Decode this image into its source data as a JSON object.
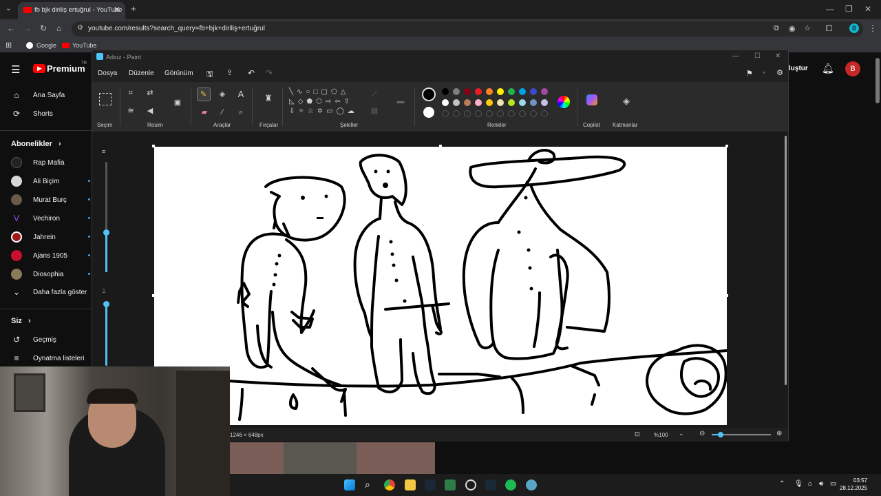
{
  "browser": {
    "tab_title": "fb bjk diriliş ertuğrul - YouTube",
    "url": "youtube.com/results?search_query=fb+bjk+diriliş+ertuğrul",
    "bookmarks": [
      "Google",
      "YouTube"
    ],
    "profile_initial": "B"
  },
  "youtube": {
    "logo": "Premium",
    "logo_region": "TR",
    "create_label": "luştur",
    "user_initial": "B",
    "nav": [
      {
        "label": "Ana Sayfa",
        "icon": "home-icon"
      },
      {
        "label": "Shorts",
        "icon": "shorts-icon"
      }
    ],
    "subscriptions_header": "Abonelikler",
    "subscriptions": [
      {
        "label": "Rap Mafia",
        "color": "#222222"
      },
      {
        "label": "Ali Biçim",
        "color": "#d8d8d8"
      },
      {
        "label": "Murat Burç",
        "color": "#6a5a4a"
      },
      {
        "label": "Vechiron",
        "color": "#7b2fbf"
      },
      {
        "label": "Jahrein",
        "color": "#a01818"
      },
      {
        "label": "Ajans 1905",
        "color": "#c8102e"
      },
      {
        "label": "Diosophia",
        "color": "#8a7a5a"
      }
    ],
    "show_more": "Daha fazla göster",
    "you_header": "Siz",
    "you_items": [
      {
        "label": "Geçmiş",
        "icon": "history-icon"
      },
      {
        "label": "Oynatma listeleri",
        "icon": "playlist-icon"
      }
    ]
  },
  "paint": {
    "window_title": "Adsız - Paint",
    "menu": [
      "Dosya",
      "Düzenle",
      "Görünüm"
    ],
    "groups": [
      "Seçim",
      "Resim",
      "Araçlar",
      "Fırçalar",
      "Şekiller",
      "Renkler",
      "Copilot",
      "Katmanlar"
    ],
    "palette_row1": [
      "#000000",
      "#7f7f7f",
      "#880015",
      "#ed1c24",
      "#ff7f27",
      "#fff200",
      "#22b14c",
      "#00a2e8",
      "#3f48cc",
      "#a349a4"
    ],
    "palette_row2": [
      "#ffffff",
      "#c3c3c3",
      "#b97a57",
      "#ffaec9",
      "#ffc90e",
      "#efe4b0",
      "#b5e61d",
      "#99d9ea",
      "#7092be",
      "#c8bfe7"
    ],
    "canvas_size": "1246 × 648px",
    "zoom": "%100"
  },
  "taskbar": {
    "time": "03:57",
    "date": "28.12.2025"
  }
}
